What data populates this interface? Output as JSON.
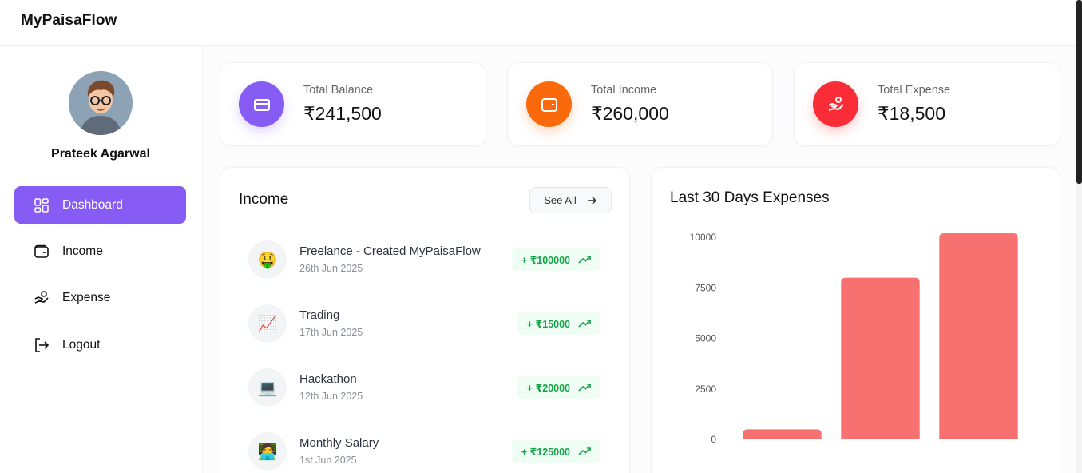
{
  "app": {
    "title": "MyPaisaFlow"
  },
  "user": {
    "name": "Prateek Agarwal"
  },
  "sidebar": {
    "items": [
      {
        "label": "Dashboard",
        "icon": "dashboard-icon",
        "active": true
      },
      {
        "label": "Income",
        "icon": "wallet-icon",
        "active": false
      },
      {
        "label": "Expense",
        "icon": "hand-coins-icon",
        "active": false
      },
      {
        "label": "Logout",
        "icon": "logout-icon",
        "active": false
      }
    ]
  },
  "stats": [
    {
      "label": "Total Balance",
      "value": "₹241,500",
      "icon": "credit-card-icon",
      "color": "#875cf5"
    },
    {
      "label": "Total Income",
      "value": "₹260,000",
      "icon": "wallet-icon",
      "color": "#fa6a0a"
    },
    {
      "label": "Total Expense",
      "value": "₹18,500",
      "icon": "hand-coins-icon",
      "color": "#fa2c37"
    }
  ],
  "income": {
    "title": "Income",
    "see_all": "See All",
    "items": [
      {
        "emoji": "🤑",
        "title": "Freelance - Created MyPaisaFlow",
        "date": "26th Jun 2025",
        "amount": "+ ₹100000"
      },
      {
        "emoji": "📈",
        "title": "Trading",
        "date": "17th Jun 2025",
        "amount": "+ ₹15000"
      },
      {
        "emoji": "💻",
        "title": "Hackathon",
        "date": "12th Jun 2025",
        "amount": "+ ₹20000"
      },
      {
        "emoji": "🧑‍💻",
        "title": "Monthly Salary",
        "date": "1st Jun 2025",
        "amount": "+ ₹125000"
      }
    ]
  },
  "expenses_chart": {
    "title": "Last 30 Days Expenses",
    "bar_color": "#f87171"
  },
  "chart_data": {
    "type": "bar",
    "title": "Last 30 Days Expenses",
    "categories": [
      "",
      "",
      ""
    ],
    "values": [
      500,
      8000,
      10200
    ],
    "ylim": [
      0,
      10000
    ],
    "yticks": [
      0,
      2500,
      5000,
      7500,
      10000
    ],
    "grid": false,
    "legend": "none"
  },
  "colors": {
    "accent": "#875cf5",
    "income_green": "#16a34a",
    "income_bg": "#f0fdf4"
  }
}
